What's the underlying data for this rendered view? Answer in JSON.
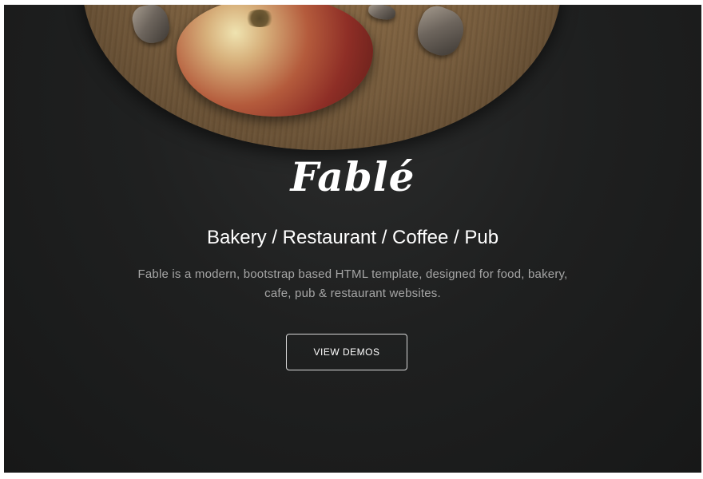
{
  "hero": {
    "logo_text": "Fablé",
    "tagline": "Bakery / Restaurant / Coffee / Pub",
    "description": "Fable is a modern, bootstrap based HTML template, designed for food, bakery, cafe, pub & restaurant websites.",
    "button_label": "VIEW DEMOS"
  },
  "colors": {
    "background": "#1c1d1d",
    "text_primary": "#ffffff",
    "text_muted": "#a6a6a6",
    "button_border": "#d8d8d8"
  }
}
